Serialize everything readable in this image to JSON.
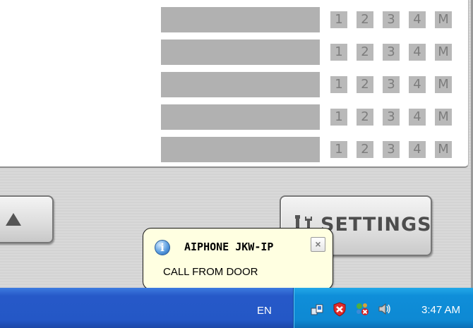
{
  "list": {
    "rows": [
      {
        "buttons": [
          "1",
          "2",
          "3",
          "4",
          "M"
        ]
      },
      {
        "buttons": [
          "1",
          "2",
          "3",
          "4",
          "M"
        ]
      },
      {
        "buttons": [
          "1",
          "2",
          "3",
          "4",
          "M"
        ]
      },
      {
        "buttons": [
          "1",
          "2",
          "3",
          "4",
          "M"
        ]
      },
      {
        "buttons": [
          "1",
          "2",
          "3",
          "4",
          "M"
        ]
      }
    ]
  },
  "controls": {
    "up_icon": "up-arrow-icon",
    "settings_label": "SETTINGS",
    "settings_icon": "tools-icon"
  },
  "notification": {
    "icon": "info-icon",
    "title": "AIPHONE JKW-IP",
    "message": "CALL FROM DOOR",
    "close_label": "×"
  },
  "taskbar": {
    "language": "EN",
    "tray_icons": [
      "network-icon",
      "security-shield-icon",
      "network-error-icon",
      "speaker-icon"
    ],
    "clock": "3:47 AM",
    "colors": {
      "taskbar": "#2457c6",
      "tray": "#0e89d3"
    }
  }
}
